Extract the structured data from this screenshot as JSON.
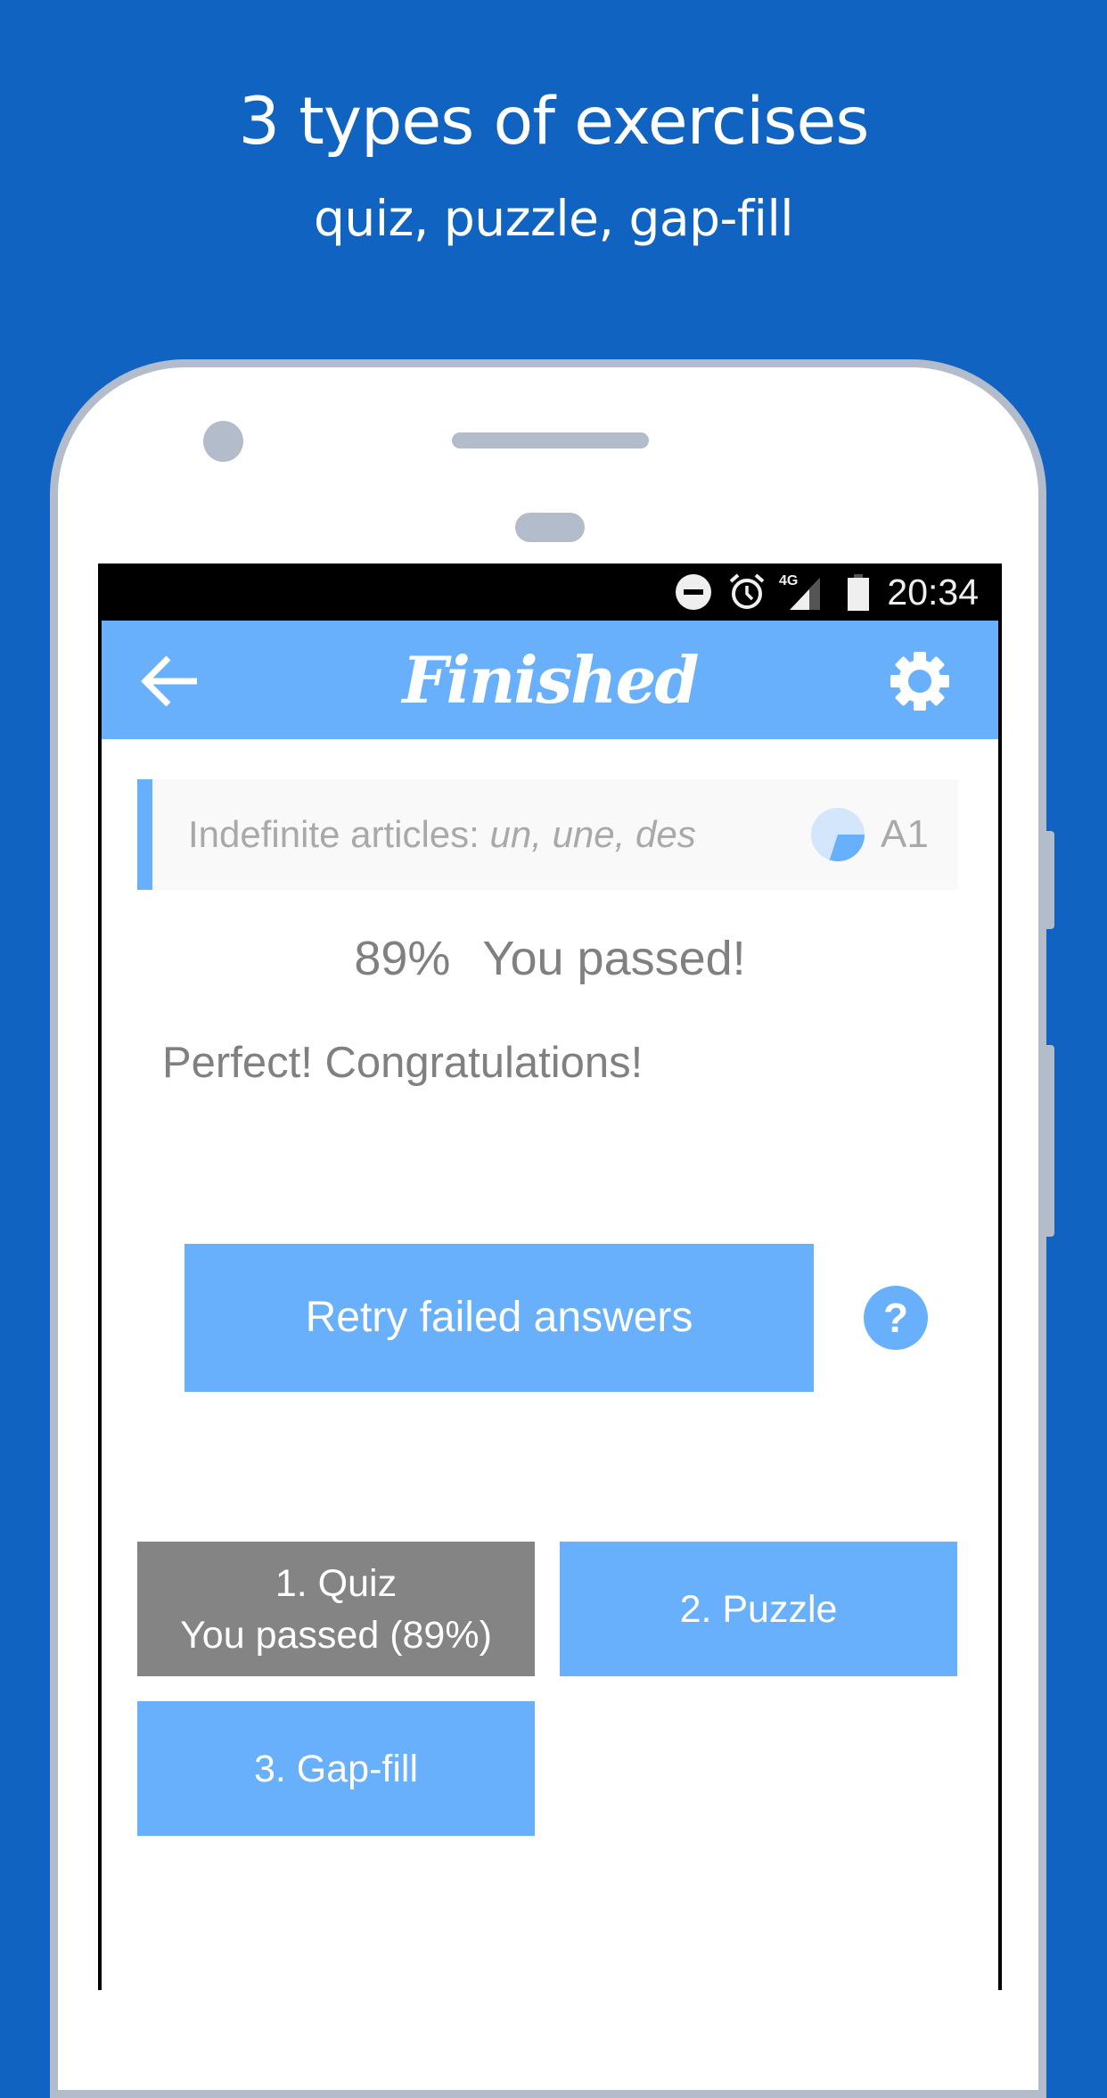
{
  "promo": {
    "headline": "3 types of exercises",
    "subline": "quiz, puzzle, gap-fill",
    "background_color": "#1163c1"
  },
  "status_bar": {
    "icons": [
      "do-not-disturb-icon",
      "alarm-icon",
      "signal-4g-icon",
      "battery-icon"
    ],
    "network_label": "4G",
    "time": "20:34"
  },
  "app_bar": {
    "title": "Finished",
    "back_icon": "arrow-left-icon",
    "settings_icon": "gear-icon",
    "color": "#68b0fc"
  },
  "topic": {
    "label": "Indefinite articles: ",
    "examples": "un, une, des",
    "level": "A1",
    "progress_fraction": 0.3
  },
  "result": {
    "score": "89%",
    "status": "You passed!",
    "message": "Perfect! Congratulations!"
  },
  "actions": {
    "retry_label": "Retry failed answers",
    "help_label": "?"
  },
  "exercises": [
    {
      "title": "1. Quiz",
      "subtitle": "You passed (89%)",
      "state": "completed",
      "color": "#848484"
    },
    {
      "title": "2. Puzzle",
      "subtitle": "",
      "state": "available",
      "color": "#68b0fc"
    },
    {
      "title": "3. Gap-fill",
      "subtitle": "",
      "state": "available",
      "color": "#68b0fc"
    }
  ]
}
